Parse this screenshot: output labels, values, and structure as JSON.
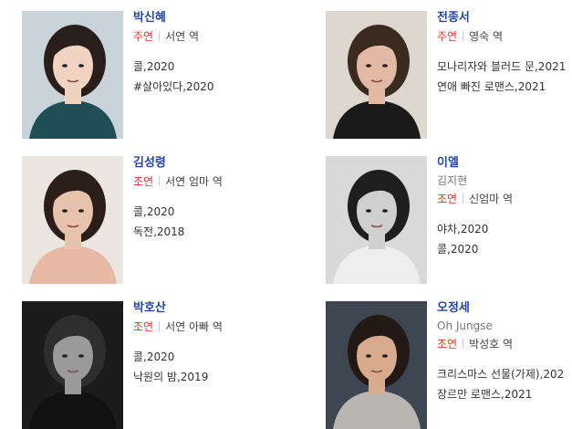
{
  "cast": [
    {
      "name": "박신혜",
      "sub": "",
      "role": "주연",
      "character": "서연 역",
      "works": [
        "콜,2020",
        "#살아있다,2020"
      ],
      "photo_icon": "portrait-photo",
      "bg": "#c9d3da",
      "skin": "#f1d3c2",
      "hair": "#2a1e1a",
      "cloth": "#1f4e56"
    },
    {
      "name": "전종서",
      "sub": "",
      "role": "주연",
      "character": "영숙 역",
      "works": [
        "모나리자와 블러드 문,2021",
        "연애 빠진 로맨스,2021"
      ],
      "photo_icon": "portrait-photo",
      "bg": "#ddd7cf",
      "skin": "#e2b9a2",
      "hair": "#3b2a20",
      "cloth": "#1a1a1a"
    },
    {
      "name": "김성령",
      "sub": "",
      "role": "조연",
      "character": "서연 엄마 역",
      "works": [
        "콜,2020",
        "독전,2018"
      ],
      "photo_icon": "portrait-photo",
      "bg": "#ece6e0",
      "skin": "#e7c3ae",
      "hair": "#2b1d17",
      "cloth": "#e8b9a4"
    },
    {
      "name": "이엘",
      "sub": "김지현",
      "role": "조연",
      "character": "신엄마 역",
      "works": [
        "야차,2020",
        "콜,2020"
      ],
      "photo_icon": "portrait-photo",
      "bg": "#d9d9d9",
      "skin": "#cfcfcf",
      "hair": "#1e1e1e",
      "cloth": "#eeeeee"
    },
    {
      "name": "박호산",
      "sub": "",
      "role": "조연",
      "character": "서연 아빠 역",
      "works": [
        "콜,2020",
        "낙원의 밤,2019"
      ],
      "photo_icon": "portrait-photo",
      "bg": "#1b1b1b",
      "skin": "#9a9a9a",
      "hair": "#2e2e2e",
      "cloth": "#111111"
    },
    {
      "name": "오정세",
      "sub": "Oh Jungse",
      "role": "조연",
      "character": "박성호 역",
      "works": [
        "크리스마스 선물(가제),202",
        "장르만 로맨스,2021"
      ],
      "photo_icon": "portrait-photo",
      "bg": "#3e4651",
      "skin": "#d9ab8e",
      "hair": "#241a15",
      "cloth": "#b9b6b2"
    }
  ]
}
